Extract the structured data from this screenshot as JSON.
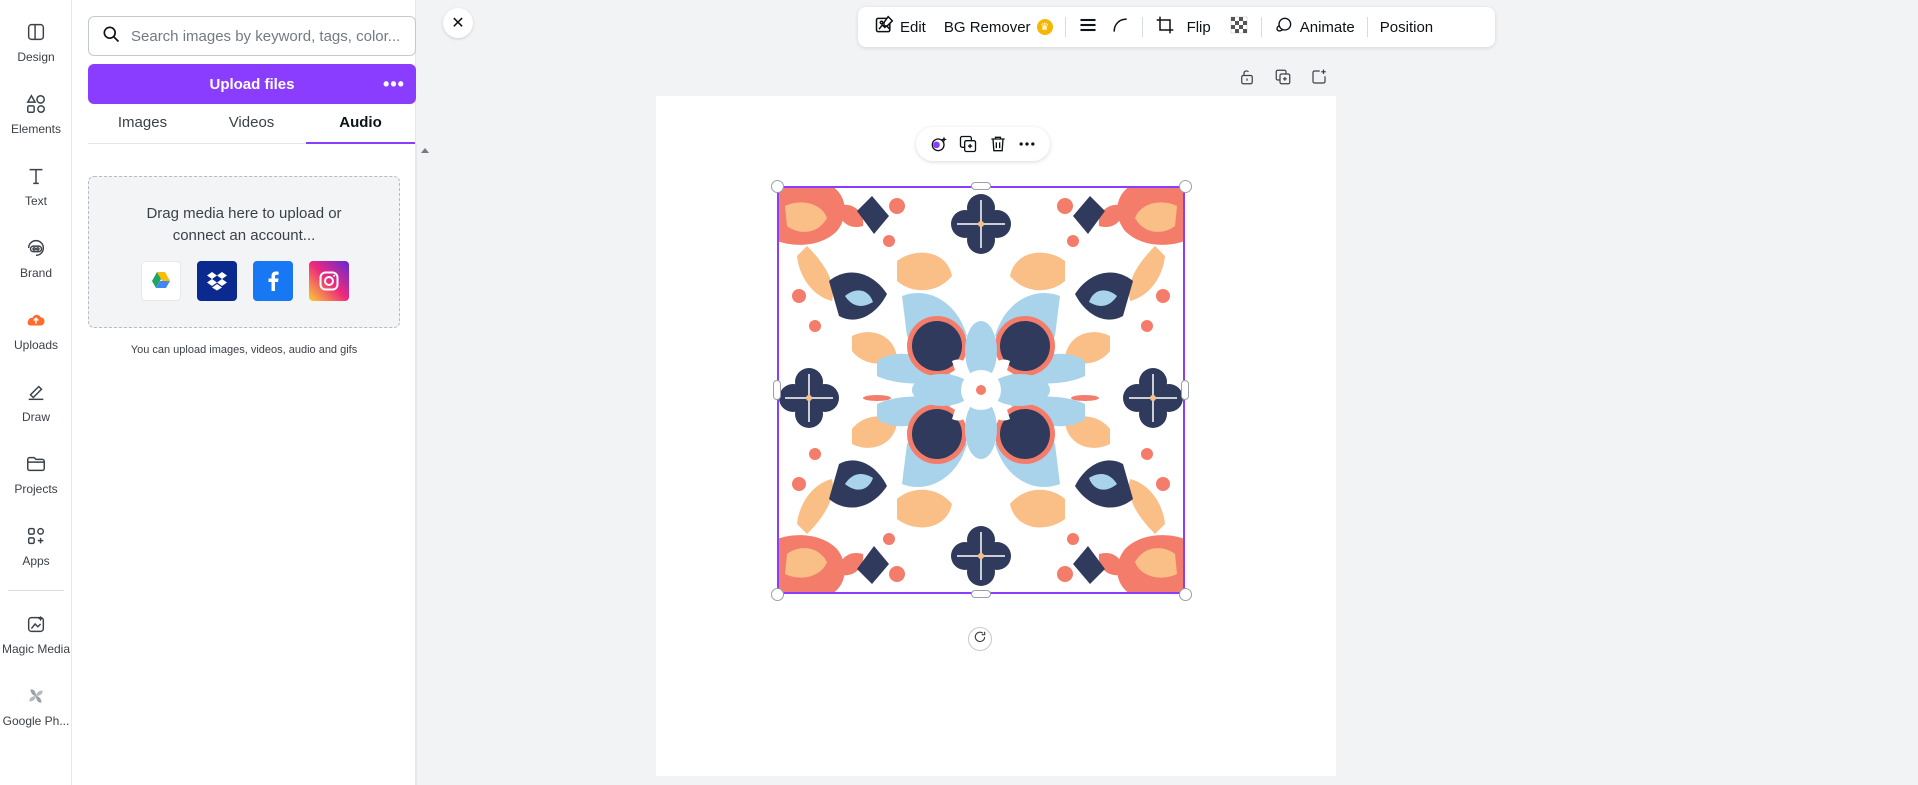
{
  "rail": {
    "items": [
      {
        "label": "Design",
        "icon": "design-icon"
      },
      {
        "label": "Elements",
        "icon": "elements-icon"
      },
      {
        "label": "Text",
        "icon": "text-icon"
      },
      {
        "label": "Brand",
        "icon": "brand-icon"
      },
      {
        "label": "Uploads",
        "icon": "uploads-icon"
      },
      {
        "label": "Draw",
        "icon": "draw-icon"
      },
      {
        "label": "Projects",
        "icon": "folder-icon"
      },
      {
        "label": "Apps",
        "icon": "apps-icon"
      },
      {
        "label": "Magic Media",
        "icon": "magic-media-icon"
      },
      {
        "label": "Google Ph...",
        "icon": "google-photos-icon"
      }
    ],
    "active": "Uploads"
  },
  "panel": {
    "search_placeholder": "Search images by keyword, tags, color...",
    "upload_button": "Upload files",
    "tabs": [
      "Images",
      "Videos",
      "Audio"
    ],
    "active_tab": "Audio",
    "dropzone_text": "Drag media here to upload or connect an account...",
    "services": [
      "google-drive-icon",
      "dropbox-icon",
      "facebook-icon",
      "instagram-icon"
    ],
    "hint": "You can upload images, videos, audio and gifs"
  },
  "toolbar": {
    "edit": "Edit",
    "bg_remover": "BG Remover",
    "flip": "Flip",
    "animate": "Animate",
    "position": "Position"
  },
  "colors": {
    "accent": "#8b3dff",
    "navy": "#2f3a5c",
    "coral": "#f47c6a",
    "peach": "#f9bf86",
    "light_blue": "#a9d3ea"
  }
}
